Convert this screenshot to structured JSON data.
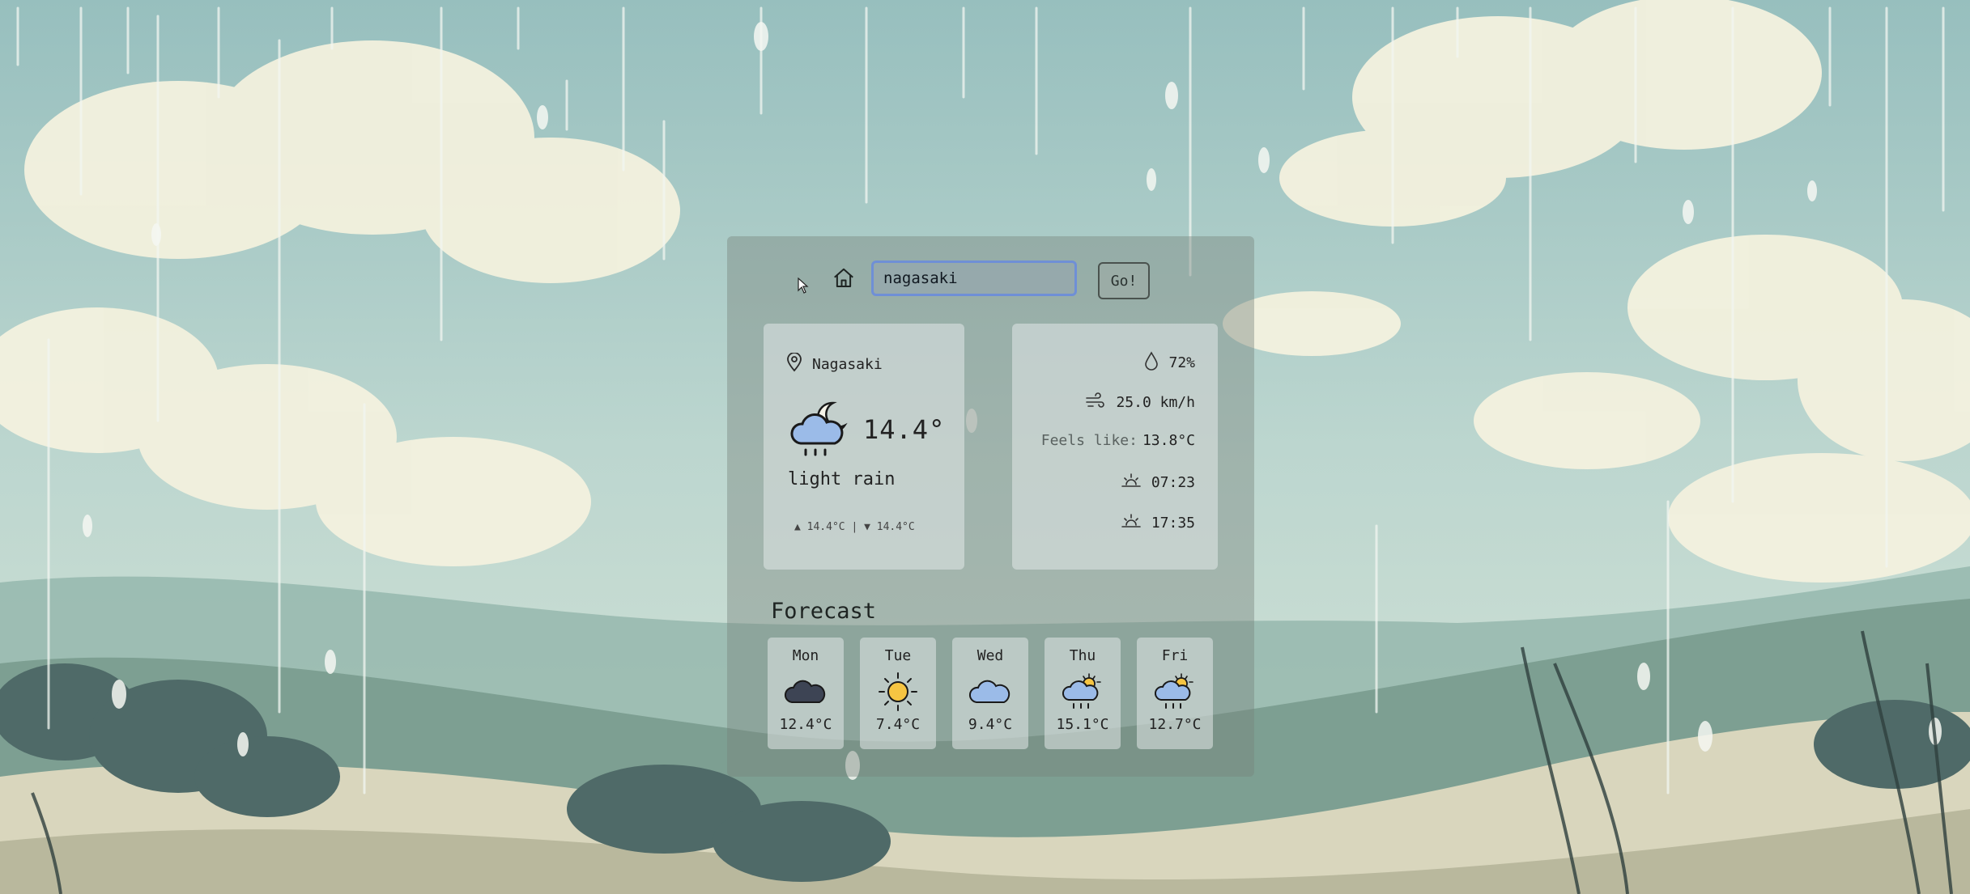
{
  "search": {
    "value": "nagasaki",
    "go_label": "Go!"
  },
  "current": {
    "location": "Nagasaki",
    "temp": "14.4°",
    "description": "light rain",
    "minmax": "▲ 14.4°C | ▼ 14.4°C",
    "icon": "cloud-moon-rain-icon"
  },
  "details": {
    "humidity": "72%",
    "wind": "25.0 km/h",
    "feels_label": "Feels like:",
    "feels_value": "13.8°C",
    "sunrise": "07:23",
    "sunset": "17:35"
  },
  "forecast": {
    "title": "Forecast",
    "days": [
      {
        "day": "Mon",
        "temp": "12.4°C",
        "icon": "dark-cloud-icon"
      },
      {
        "day": "Tue",
        "temp": "7.4°C",
        "icon": "sun-icon"
      },
      {
        "day": "Wed",
        "temp": "9.4°C",
        "icon": "cloud-icon"
      },
      {
        "day": "Thu",
        "temp": "15.1°C",
        "icon": "sun-cloud-rain-icon"
      },
      {
        "day": "Fri",
        "temp": "12.7°C",
        "icon": "sun-cloud-rain-icon"
      }
    ]
  },
  "colors": {
    "accent_border": "#6f8fd6",
    "top_bar": "#1f5a55"
  }
}
